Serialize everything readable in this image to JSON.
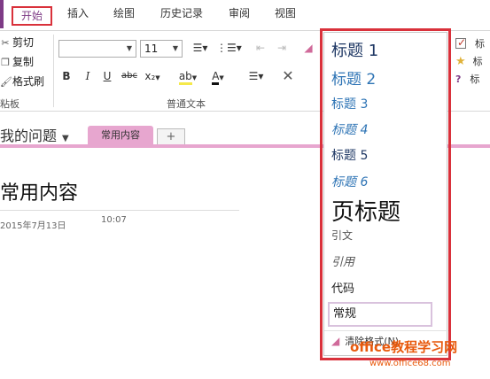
{
  "tabs": [
    "开始",
    "插入",
    "绘图",
    "历史记录",
    "审阅",
    "视图"
  ],
  "clipboard": {
    "cut": "剪切",
    "copy": "复制",
    "format_painter": "格式刷",
    "group_label": "粘板"
  },
  "font": {
    "name": "",
    "size": "11",
    "group_label": "普通文本",
    "bold": "B",
    "italic": "I",
    "underline": "U",
    "strikethrough": "abc",
    "subscript": "x₂",
    "font_color_glyph": "A"
  },
  "styles": {
    "items": [
      "标题 1",
      "标题 2",
      "标题 3",
      "标题 4",
      "标题 5",
      "标题 6",
      "页标题",
      "引文",
      "引用",
      "代码",
      "常规"
    ],
    "clear": "清除格式(N)"
  },
  "tags": [
    "标",
    "标",
    "标"
  ],
  "notebook": {
    "section_title": "我的问题",
    "page_tab": "常用内容",
    "add_tab": "+"
  },
  "page": {
    "title": "常用内容",
    "date": "2015年7月13日",
    "time": "10:07"
  },
  "watermark": {
    "line1": "office教程学习网",
    "line2": "www.office68.com"
  },
  "colors": {
    "accent": "#7e3b86",
    "highlight_frame": "#d9313b",
    "section_tab": "#e7a6cf"
  }
}
